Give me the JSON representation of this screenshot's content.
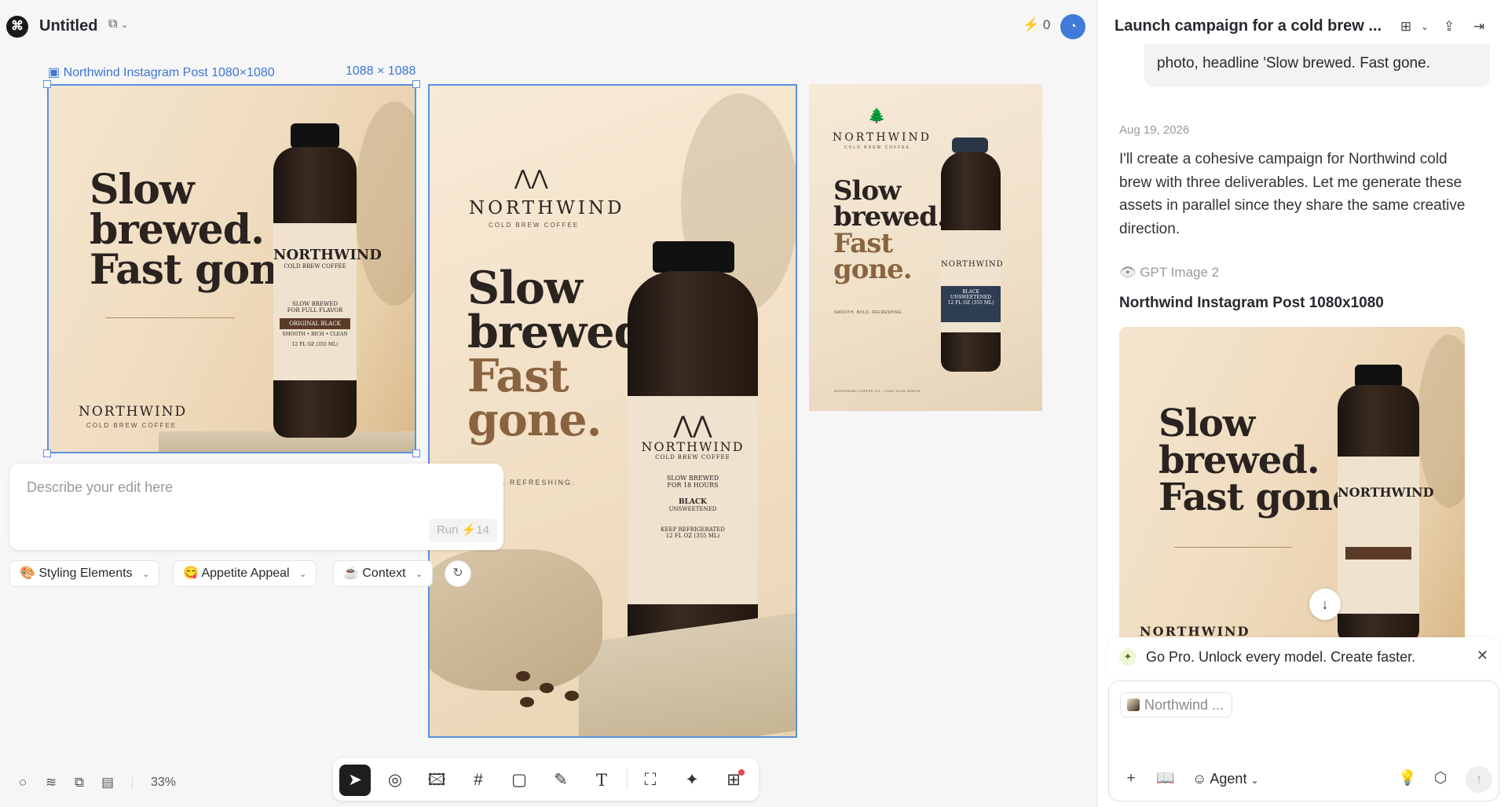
{
  "header": {
    "title": "Untitled",
    "credits": "0",
    "logo_icon": "app-logo-icon",
    "doc_icon": "sync-icon"
  },
  "canvas": {
    "selected_frame": {
      "label": "Northwind Instagram Post 1080×1080",
      "size": "1088 × 1088"
    },
    "artworks": [
      {
        "headline": [
          "Slow",
          "brewed.",
          "Fast gone."
        ],
        "brand": "NORTHWIND",
        "brand_sub": "COLD BREW COFFEE",
        "label_lines": [
          "SLOW BREWED",
          "FOR FULL FLAVOR",
          "ORIGINAL BLACK",
          "SMOOTH • RICH • CLEAN",
          "12 FL OZ (355 ML)"
        ]
      },
      {
        "brand": "NORTHWIND",
        "brand_sub": "COLD BREW COFFEE",
        "headline": [
          "Slow",
          "brewed.",
          "Fast",
          "gone."
        ],
        "tagline": "SMOOTH. BOLD. REFRESHING.",
        "label_lines": [
          "SLOW BREWED",
          "FOR 18 HOURS",
          "BLACK",
          "UNSWEETENED",
          "KEEP REFRIGERATED",
          "12 FL OZ (355 ML)"
        ]
      },
      {
        "brand": "NORTHWIND",
        "brand_sub": "COLD BREW COFFEE",
        "headline": [
          "Slow",
          "brewed.",
          "Fast",
          "gone."
        ],
        "tagline": "SMOOTH. BOLD. REFRESHING.",
        "footer": "NORTHWIND COFFEE CO.   |   FIND YOUR NORTH",
        "label_lines": [
          "BLACK",
          "UNSWEETENED",
          "12 FL OZ (355 ML)"
        ]
      }
    ],
    "edit_prompt": {
      "placeholder": "Describe your edit here",
      "run_label": "Run",
      "run_cost": "14"
    },
    "chips": [
      {
        "icon": "🎨",
        "label": "Styling Elements"
      },
      {
        "icon": "😋",
        "label": "Appetite Appeal"
      },
      {
        "icon": "☕",
        "label": "Context"
      }
    ],
    "zoom": "33%"
  },
  "toolbar": {
    "tools": [
      "select-tool",
      "pin-tool",
      "image-tool",
      "frame-tool",
      "rectangle-tool",
      "pen-tool",
      "text-tool",
      "image-gen-tool",
      "video-gen-tool",
      "template-tool"
    ]
  },
  "panel": {
    "title": "Launch campaign for a cold brew ...",
    "user_message_tail": "photo, headline 'Slow brewed. Fast gone.",
    "date": "Aug 19, 2026",
    "assistant_text": "I'll create a cohesive campaign for Northwind cold brew with three deliverables. Let me generate these assets in parallel since they share the same creative direction.",
    "model": "GPT Image 2",
    "asset_title": "Northwind Instagram Post 1080x1080",
    "asset_headline": [
      "Slow",
      "brewed.",
      "Fast gone."
    ],
    "asset_brand": "NORTHWIND",
    "promo": "Go Pro. Unlock every model. Create faster.",
    "composer": {
      "reference": "Northwind ...",
      "mode": "Agent"
    }
  },
  "colors": {
    "accent": "#5b8fe0",
    "brand_brown": "#8a6440",
    "dark": "#1e1e1e"
  }
}
